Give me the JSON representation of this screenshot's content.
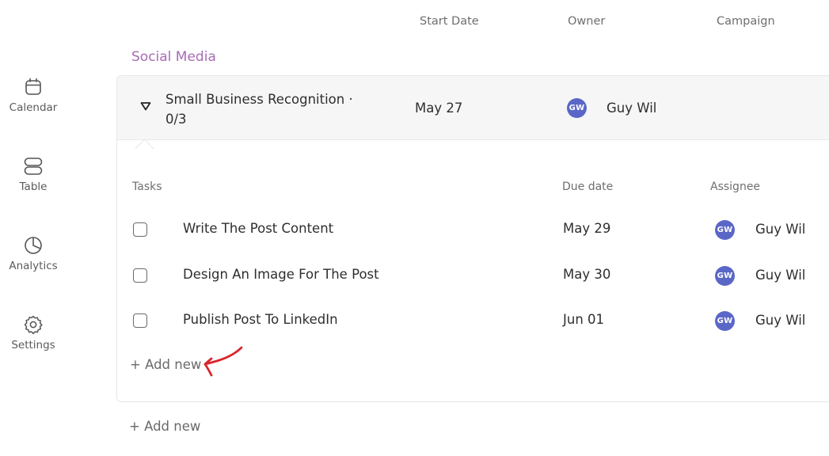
{
  "sidebar": {
    "items": [
      {
        "label": "Calendar",
        "icon": "calendar-icon"
      },
      {
        "label": "Table",
        "icon": "table-icon"
      },
      {
        "label": "Analytics",
        "icon": "pie-chart-icon"
      },
      {
        "label": "Settings",
        "icon": "gear-icon"
      }
    ]
  },
  "columns": {
    "start_date": "Start Date",
    "owner": "Owner",
    "campaign": "Campaign"
  },
  "group": {
    "title": "Social Media",
    "accent_color": "#a86bb5"
  },
  "project": {
    "name": "Small Business Recognition · 0/3",
    "start_date": "May 27",
    "owner_initials": "GW",
    "owner_name": "Guy Wil"
  },
  "subtable": {
    "headers": {
      "tasks": "Tasks",
      "due_date": "Due date",
      "assignee": "Assignee"
    },
    "tasks": [
      {
        "name": "Write The Post Content",
        "due": "May 29",
        "assignee_initials": "GW",
        "assignee_name": "Guy Wil",
        "done": false
      },
      {
        "name": "Design An Image For The Post",
        "due": "May 30",
        "assignee_initials": "GW",
        "assignee_name": "Guy Wil",
        "done": false
      },
      {
        "name": "Publish Post To LinkedIn",
        "due": "Jun 01",
        "assignee_initials": "GW",
        "assignee_name": "Guy Wil",
        "done": false
      }
    ],
    "add_new_label": "+ Add new"
  },
  "group_add_new_label": "+ Add new",
  "avatar_color": "#5a67c7",
  "annotation_arrow_color": "#d9262c"
}
